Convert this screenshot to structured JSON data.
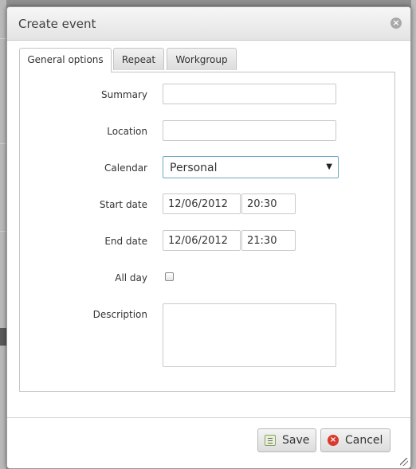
{
  "dialog": {
    "title": "Create event",
    "close_icon": "close-icon"
  },
  "tabs": [
    {
      "label": "General options",
      "active": true
    },
    {
      "label": "Repeat",
      "active": false
    },
    {
      "label": "Workgroup",
      "active": false
    }
  ],
  "form": {
    "summary": {
      "label": "Summary",
      "value": ""
    },
    "location": {
      "label": "Location",
      "value": ""
    },
    "calendar": {
      "label": "Calendar",
      "value": "Personal"
    },
    "start_date": {
      "label": "Start date",
      "date": "12/06/2012",
      "time": "20:30"
    },
    "end_date": {
      "label": "End date",
      "date": "12/06/2012",
      "time": "21:30"
    },
    "all_day": {
      "label": "All day",
      "checked": false
    },
    "description": {
      "label": "Description",
      "value": ""
    }
  },
  "buttons": {
    "save": {
      "label": "Save",
      "icon": "save-icon"
    },
    "cancel": {
      "label": "Cancel",
      "icon": "cancel-icon"
    }
  },
  "colors": {
    "select_border": "#6fa6c6",
    "cancel_icon": "#d83a2b"
  }
}
